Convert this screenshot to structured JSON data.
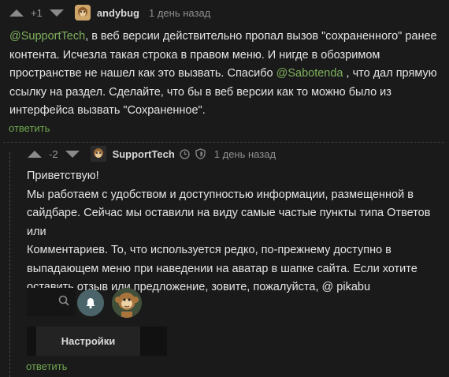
{
  "comment1": {
    "rating": "+1",
    "username": "andybug",
    "time": "1 день назад",
    "avatar_icon": "monkey-avatar",
    "mention1": "@SupportTech",
    "line1_rest": ", в веб версии действительно пропал вызов \"сохраненного\" ранее",
    "line2": "контента. Исчезла такая строка в правом меню. И нигде в обозримом",
    "line3_a": "пространстве не нашел как это вызвать. Спасибо ",
    "mention2": "@Sabotenda",
    "line3_b": " , что дал прямую",
    "line4": "ссылку на раздел. Сделайте, что бы в веб версии как то можно было из",
    "line5": "интерфейса вызвать \"Сохраненное\".",
    "reply": "ответить"
  },
  "comment2": {
    "rating": "-2",
    "username": "SupportTech",
    "time": "1 день назад",
    "avatar_icon": "monkey-avatar",
    "line1": "Приветствую!",
    "line2": "Мы работаем с удобством и доступностью информации, размещенной в",
    "line3": "сайдбаре. Сейчас мы оставили на виду самые частые пункты типа Ответов или",
    "line4": "Комментариев. То, что используется редко, по-прежнему доступно в",
    "line5": "выпадающем меню при наведении на аватар в шапке сайта. Если хотите",
    "line6": "оставить отзыв или предложение, зовите, пожалуйста, @ pikabu",
    "reply": "ответить"
  },
  "screenshot": {
    "search_icon": "search-icon",
    "bell_icon": "bell-icon",
    "menu_item": "Настройки"
  },
  "colors": {
    "background": "#1a1a1a",
    "link": "#6fa84f",
    "mention": "#7fb15e",
    "bell_bg": "#4a6469"
  }
}
